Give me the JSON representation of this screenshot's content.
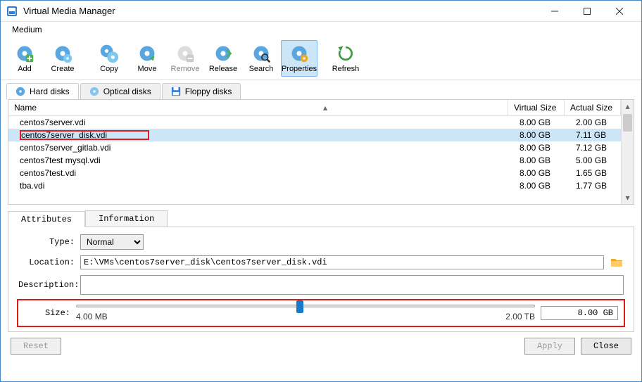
{
  "window": {
    "title": "Virtual Media Manager"
  },
  "menu": {
    "medium": "Medium"
  },
  "toolbar": {
    "add": "Add",
    "create": "Create",
    "copy": "Copy",
    "move": "Move",
    "remove": "Remove",
    "release": "Release",
    "search": "Search",
    "properties": "Properties",
    "refresh": "Refresh"
  },
  "tabs": {
    "hard_disks": "Hard disks",
    "optical_disks": "Optical disks",
    "floppy_disks": "Floppy disks"
  },
  "table": {
    "columns": {
      "name": "Name",
      "vsize": "Virtual Size",
      "asize": "Actual Size"
    },
    "rows": [
      {
        "name": "centos7server.vdi",
        "vsize": "8.00 GB",
        "asize": "2.00 GB",
        "selected": false,
        "highlighted": false
      },
      {
        "name": "centos7server_disk.vdi",
        "vsize": "8.00 GB",
        "asize": "7.11 GB",
        "selected": true,
        "highlighted": true
      },
      {
        "name": "centos7server_gitlab.vdi",
        "vsize": "8.00 GB",
        "asize": "7.12 GB",
        "selected": false,
        "highlighted": false
      },
      {
        "name": "centos7test mysql.vdi",
        "vsize": "8.00 GB",
        "asize": "5.00 GB",
        "selected": false,
        "highlighted": false
      },
      {
        "name": "centos7test.vdi",
        "vsize": "8.00 GB",
        "asize": "1.65 GB",
        "selected": false,
        "highlighted": false
      },
      {
        "name": "tba.vdi",
        "vsize": "8.00 GB",
        "asize": "1.77 GB",
        "selected": false,
        "highlighted": false
      }
    ]
  },
  "props_tabs": {
    "attributes": "Attributes",
    "information": "Information"
  },
  "form": {
    "type_label": "Type:",
    "type_value": "Normal",
    "location_label": "Location:",
    "location_value": "E:\\VMs\\centos7server_disk\\centos7server_disk.vdi",
    "description_label": "Description:",
    "description_value": "",
    "size_label": "Size:",
    "size_value": "8.00 GB",
    "size_min": "4.00 MB",
    "size_max": "2.00 TB"
  },
  "buttons": {
    "reset": "Reset",
    "apply": "Apply",
    "close": "Close"
  }
}
